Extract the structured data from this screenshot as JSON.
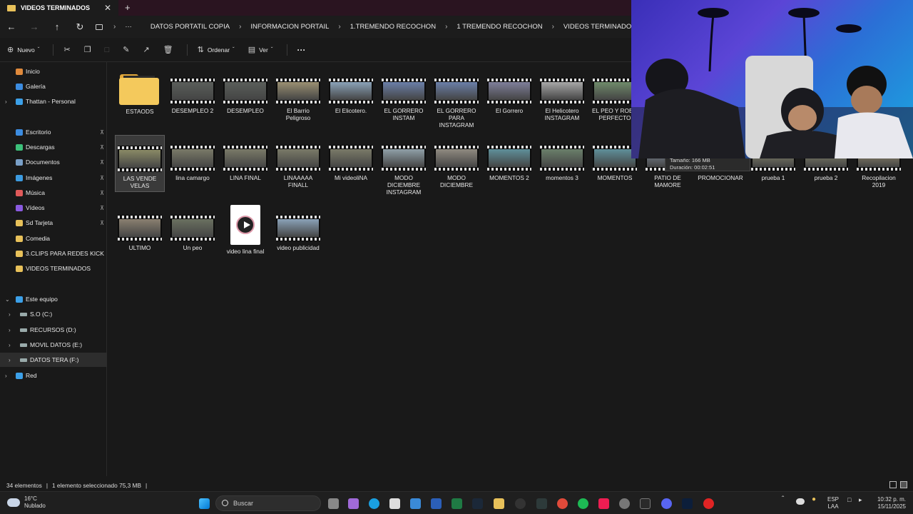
{
  "window": {
    "tab_title": "VIDEOS TERMINADOS",
    "tab_close": "✕",
    "new_tab": "+"
  },
  "address": {
    "ellipsis": "···",
    "crumbs": [
      "DATOS PORTATIL COPIA",
      "INFORMACION PORTAIL",
      "1.TREMENDO RECOCHON",
      "1 TREMENDO RECOCHON",
      "VIDEOS TERMINADOS"
    ]
  },
  "toolbar": {
    "new_label": "Nuevo",
    "sort_label": "Ordenar",
    "view_label": "Ver",
    "more": "···"
  },
  "sidebar": {
    "items": [
      {
        "label": "Inicio",
        "color": "#e08a3c"
      },
      {
        "label": "Galería",
        "color": "#3c8ce0"
      },
      {
        "label": "Thattan - Personal",
        "color": "#3ca0e8"
      },
      {
        "label": "Escritorio",
        "color": "#3c8ce0"
      },
      {
        "label": "Descargas",
        "color": "#3cc07a"
      },
      {
        "label": "Documentos",
        "color": "#7aa0c8"
      },
      {
        "label": "Imágenes",
        "color": "#3c9be0"
      },
      {
        "label": "Música",
        "color": "#e05a5a"
      },
      {
        "label": "Vídeos",
        "color": "#8a5ae0"
      },
      {
        "label": "Sd Tarjeta",
        "color": "#e8c15a"
      },
      {
        "label": "Comedia",
        "color": "#e8c15a"
      },
      {
        "label": "3.CLIPS PARA REDES KICK",
        "color": "#e8c15a"
      },
      {
        "label": "VIDEOS TERMINADOS",
        "color": "#e8c15a"
      },
      {
        "label": "Este equipo",
        "color": "#3ca0e8"
      },
      {
        "label": "S.O (C:)",
        "color": "#9aa"
      },
      {
        "label": "RECURSOS (D:)",
        "color": "#9aa"
      },
      {
        "label": "MOVIL DATOS (E:)",
        "color": "#9aa"
      },
      {
        "label": "DATOS TERA (F:)",
        "color": "#9aa"
      },
      {
        "label": "Red",
        "color": "#3ca0e8"
      }
    ]
  },
  "files": [
    {
      "name": "ESTAODS",
      "kind": "folder"
    },
    {
      "name": "DESEMPLEO 2",
      "kind": "video",
      "tone": "#5a5e5a"
    },
    {
      "name": "DESEMPLEO",
      "kind": "video",
      "tone": "#5a5e5a"
    },
    {
      "name": "El Barrio Peligroso",
      "kind": "video",
      "tone": "#9a8f72"
    },
    {
      "name": "El Elicotero.",
      "kind": "video",
      "tone": "#8aa2b8"
    },
    {
      "name": "EL GORRERO INSTAM",
      "kind": "video",
      "tone": "#6b7fa8"
    },
    {
      "name": "EL GORRERO PARA INSTAGRAM",
      "kind": "video",
      "tone": "#6b7fa8"
    },
    {
      "name": "El Gorrero",
      "kind": "video",
      "tone": "#7f7f9a"
    },
    {
      "name": "El Helicotero INSTAGRAM",
      "kind": "video",
      "tone": "#a7a7a7"
    },
    {
      "name": "EL PEO Y ROBO PERFECTO",
      "kind": "video",
      "tone": "#6f8a6a"
    },
    {
      "name": "LAS VENDE VELAS",
      "kind": "video",
      "tone": "#8a8a66"
    },
    {
      "name": "lina camargo",
      "kind": "video",
      "tone": "#7a7a68"
    },
    {
      "name": "LINA FINAL",
      "kind": "video",
      "tone": "#7a7a68"
    },
    {
      "name": "LINAAAAA FINALL",
      "kind": "video",
      "tone": "#7a7a68"
    },
    {
      "name": "Mi videoliNA",
      "kind": "video",
      "tone": "#7a7a68"
    },
    {
      "name": "MODO DICIEMBRE INSTAGRAM",
      "kind": "video",
      "tone": "#8fa0a8"
    },
    {
      "name": "MODO DICIEMBRE",
      "kind": "video",
      "tone": "#8f8a80"
    },
    {
      "name": "MOMENTOS 2",
      "kind": "video",
      "tone": "#5f8f9a"
    },
    {
      "name": "momentos 3",
      "kind": "video",
      "tone": "#6a7f6a"
    },
    {
      "name": "MOMENTOS",
      "kind": "video",
      "tone": "#5f8f9a"
    },
    {
      "name": "PATIO DE MAMORE",
      "kind": "video",
      "tone": "#7f8a9a"
    },
    {
      "name": "PROMOCIONAR",
      "kind": "video",
      "tone": "#8a8a70"
    },
    {
      "name": "prueba 1",
      "kind": "video",
      "tone": "#8a8a70"
    },
    {
      "name": "prueba 2",
      "kind": "video",
      "tone": "#8a8a70"
    },
    {
      "name": "Recopilacion 2019",
      "kind": "video",
      "tone": "#9a8f72"
    },
    {
      "name": "ULTIMO",
      "kind": "video",
      "tone": "#8a8070"
    },
    {
      "name": "Un peo",
      "kind": "video",
      "tone": "#6a7060"
    },
    {
      "name": "video lina final",
      "kind": "file"
    },
    {
      "name": "video publicidad",
      "kind": "video",
      "tone": "#8aa2b8"
    }
  ],
  "tooltip": {
    "size": "Tamaño: 166 MB",
    "duration": "Duración: 00:02:51"
  },
  "status": {
    "count": "34 elementos",
    "sep": "|",
    "selected": "1 elemento seleccionado 75,3 MB"
  },
  "taskbar": {
    "weather_temp": "16°C",
    "weather_desc": "Nublado",
    "search_label": "Buscar",
    "lang1": "ESP",
    "lang2": "LAA",
    "time": "10:32 p. m.",
    "date": "15/11/2025"
  }
}
